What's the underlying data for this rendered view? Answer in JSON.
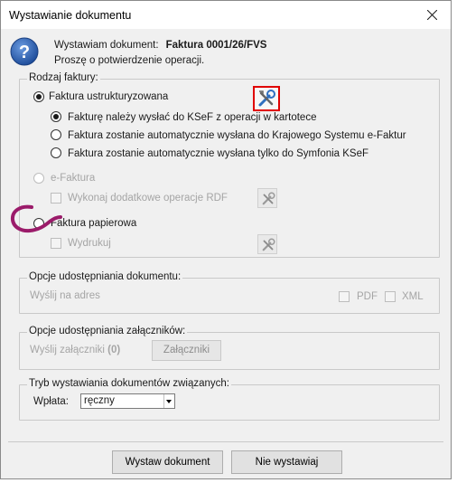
{
  "window": {
    "title": "Wystawianie dokumentu"
  },
  "header": {
    "prefix": "Wystawiam dokument:",
    "document_number": "Faktura 0001/26/FVS",
    "confirm": "Proszę o potwierdzenie operacji."
  },
  "invoice_type": {
    "legend": "Rodzaj faktury:",
    "structured": {
      "label": "Faktura ustrukturyzowana",
      "options": [
        {
          "label": "Fakturę należy wysłać do KSeF z operacji w kartotece",
          "selected": true
        },
        {
          "label": "Faktura zostanie automatycznie wysłana do Krajowego Systemu e-Faktur",
          "selected": false
        },
        {
          "label": "Faktura zostanie automatycznie wysłana tylko do Symfonia KSeF",
          "selected": false
        }
      ]
    },
    "efaktura": {
      "label": "e-Faktura",
      "rdf_label": "Wykonaj dodatkowe operacje RDF"
    },
    "paper": {
      "label": "Faktura papierowa",
      "print_label": "Wydrukuj"
    }
  },
  "sharing": {
    "legend": "Opcje udostępniania dokumentu:",
    "send_label": "Wyślij na adres",
    "pdf_label": "PDF",
    "xml_label": "XML"
  },
  "attachments": {
    "legend": "Opcje udostępniania załączników:",
    "send_label": "Wyślij załączniki",
    "count": "(0)",
    "button": "Załączniki"
  },
  "related": {
    "legend": "Tryb wystawiania dokumentów związanych:",
    "payment_label": "Wpłata:",
    "payment_value": "ręczny"
  },
  "footer": {
    "issue_button": "Wystaw dokument",
    "cancel_button": "Nie wystawiaj"
  },
  "colors": {
    "highlight_border": "#e00000",
    "annotation": "#9b1b6a",
    "info_icon": "#2d5fb0"
  },
  "icons": [
    "close-icon",
    "question-icon",
    "tools-icon"
  ]
}
